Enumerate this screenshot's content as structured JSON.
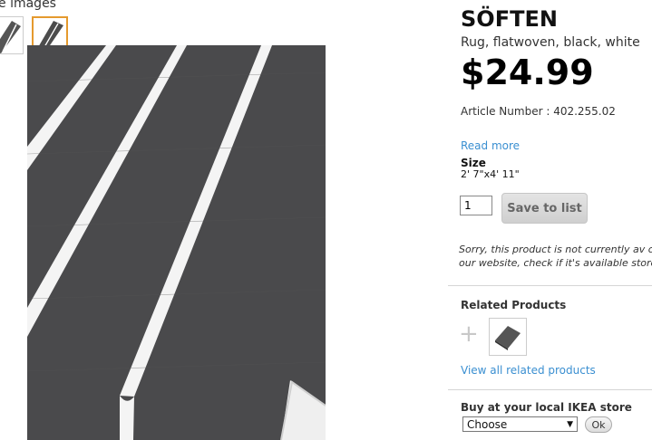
{
  "gallery": {
    "more_images_label": "ore images"
  },
  "product": {
    "name": "SÖFTEN",
    "description": "Rug, flatwoven, black, white",
    "price": "$24.99",
    "article_number": "Article Number : 402.255.02",
    "read_more": "Read more",
    "size_label": "Size",
    "size_value": "2' 7\"x4' 11\"",
    "quantity": "1",
    "save_button": "Save to list",
    "availability_note": "Sorry, this product is not currently av on our website, check if it's available store."
  },
  "related": {
    "title": "Related Products",
    "plus": "+",
    "view_all": "View all related products"
  },
  "local_store": {
    "title": "Buy at your local IKEA store",
    "select_value": "Choose",
    "ok_button": "Ok"
  },
  "colors": {
    "link": "#3a8fd1",
    "selected_thumb_border": "#e59a2e",
    "rug": "#4a4a4c",
    "stripe": "#f4f4f4"
  }
}
